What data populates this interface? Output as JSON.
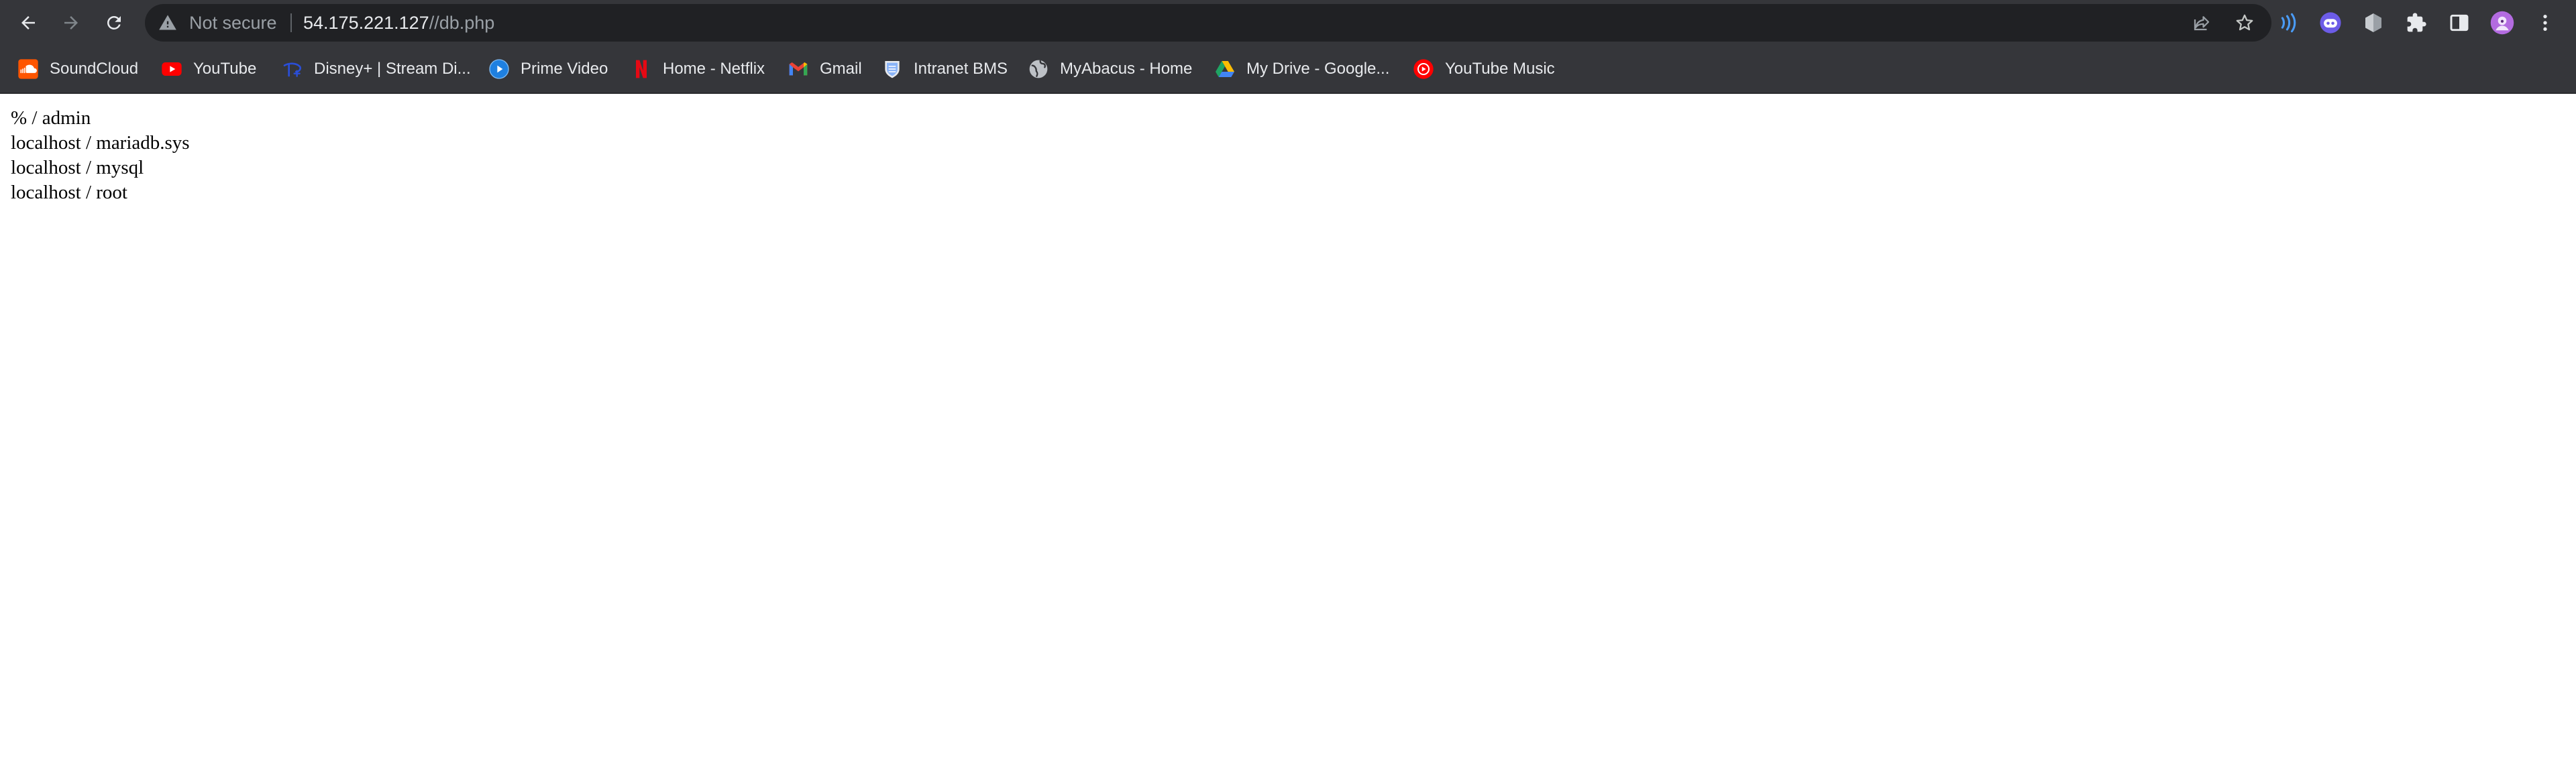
{
  "toolbar": {
    "back_icon": "arrow-left-icon",
    "forward_icon": "arrow-right-icon",
    "reload_icon": "reload-icon",
    "share_icon": "share-icon",
    "bookmark_star_icon": "star-icon",
    "extensions_icon": "puzzle-icon",
    "side_panel_icon": "side-panel-icon",
    "menu_icon": "kebab-menu-icon"
  },
  "omnibox": {
    "security_icon": "warning-triangle-icon",
    "security_label": "Not secure",
    "url_host": "54.175.221.127",
    "url_path": "//db.php"
  },
  "extensions": [
    {
      "icon": "signal-waves-icon",
      "color": "#4a9bf5"
    },
    {
      "icon": "ghost-bot-icon",
      "color": "#6c5ce7"
    },
    {
      "icon": "hexagon-shield-icon",
      "color": "#9aa0a6"
    }
  ],
  "profile": {
    "icon": "avatar-icon",
    "color": "#b36be0"
  },
  "bookmarks": [
    {
      "label": "SoundCloud",
      "icon": "soundcloud-icon",
      "color": "#ff5500"
    },
    {
      "label": "YouTube",
      "icon": "youtube-icon",
      "color": "#ff0000"
    },
    {
      "label": "Disney+ | Stream Di...",
      "icon": "disney-plus-icon",
      "color": "#2a4ed8"
    },
    {
      "label": "Prime Video",
      "icon": "prime-video-icon",
      "color": "#1f80e0"
    },
    {
      "label": "Home - Netflix",
      "icon": "netflix-icon",
      "color": "#e50914"
    },
    {
      "label": "Gmail",
      "icon": "gmail-icon",
      "color": "#ea4335"
    },
    {
      "label": "Intranet BMS",
      "icon": "shield-crest-icon",
      "color": "#8ab4f8"
    },
    {
      "label": "MyAbacus - Home",
      "icon": "globe-icon",
      "color": "#bdc1c6"
    },
    {
      "label": "My Drive - Google...",
      "icon": "google-drive-icon",
      "color": "#fbbc04"
    },
    {
      "label": "YouTube Music",
      "icon": "youtube-music-icon",
      "color": "#ff0000"
    }
  ],
  "page": {
    "lines": [
      "% / admin",
      "localhost / mariadb.sys",
      "localhost / mysql",
      "localhost / root"
    ]
  }
}
